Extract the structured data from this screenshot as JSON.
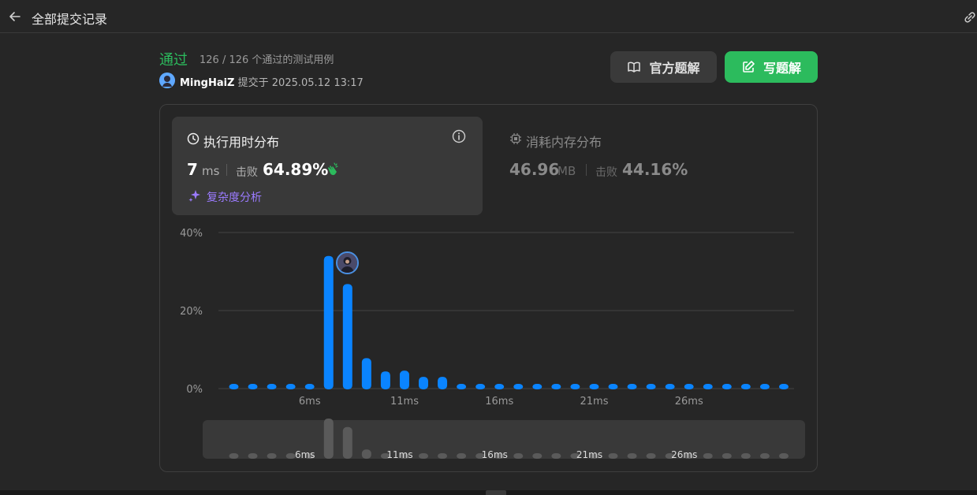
{
  "topbar": {
    "title": "全部提交记录"
  },
  "submission": {
    "status": "通过",
    "testcases": "126 / 126 个通过的测试用例",
    "username": "MingHaiZ",
    "submitted_at": "提交于 2025.05.12 13:17"
  },
  "buttons": {
    "official": "官方题解",
    "write": "写题解"
  },
  "runtime": {
    "title": "执行用时分布",
    "value": "7",
    "unit": "ms",
    "beats_label": "击败",
    "beats": "64.89%",
    "complexity": "复杂度分析"
  },
  "memory": {
    "title": "消耗内存分布",
    "value": "46.96",
    "unit": "MB",
    "beats_label": "击败",
    "beats": "44.16%"
  },
  "colors": {
    "accent": "#2cbb5d",
    "bar": "#0a84ff",
    "purple": "#9b7bff"
  },
  "chart_data": {
    "type": "bar",
    "y_ticks": [
      "40%",
      "20%",
      "0%"
    ],
    "ylim": [
      0,
      40
    ],
    "x_ticks": [
      "6ms",
      "11ms",
      "16ms",
      "21ms",
      "26ms"
    ],
    "x": [
      1,
      2,
      3,
      4,
      5,
      6,
      7,
      8,
      9,
      10,
      11,
      12,
      13,
      14,
      15,
      16,
      17,
      18,
      19,
      20,
      21,
      22,
      23,
      24,
      25,
      26,
      27,
      28,
      29,
      30
    ],
    "values": [
      1.2,
      1.2,
      1.2,
      1.2,
      1.2,
      34,
      26.8,
      7.8,
      4.4,
      4.6,
      3,
      3,
      1.2,
      1.2,
      1.2,
      1.2,
      1.2,
      1.2,
      1.2,
      1.2,
      1.2,
      1.2,
      1.2,
      1.2,
      1.2,
      1.2,
      1.2,
      1.2,
      1.2,
      1.2
    ],
    "highlight_x": 7
  }
}
